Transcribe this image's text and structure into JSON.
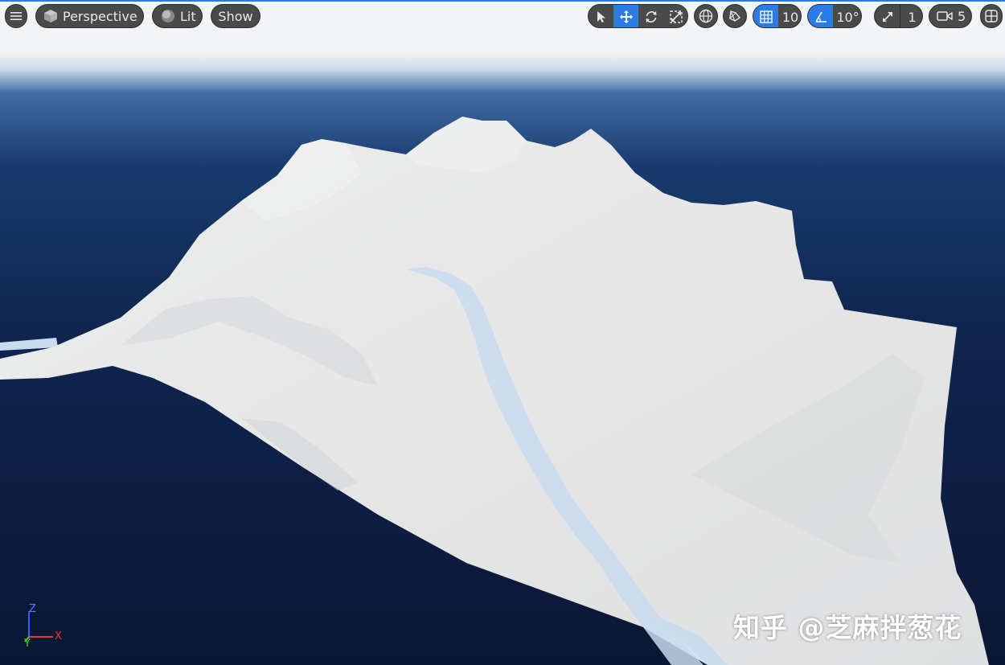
{
  "toolbar": {
    "view_mode_label": "Perspective",
    "lighting_label": "Lit",
    "show_label": "Show",
    "grid_snap_value": "10",
    "rotation_snap_value": "10°",
    "scale_snap_value": "1",
    "camera_speed_value": "5",
    "active_transform_tool": "translate",
    "icons": [
      "menu-icon",
      "perspective-cube-icon",
      "lit-sphere-icon",
      "select-arrow-icon",
      "translate-icon",
      "rotate-icon",
      "scale-icon",
      "world-local-icon",
      "surface-snap-icon",
      "grid-snap-icon",
      "rotation-snap-icon",
      "scale-snap-icon",
      "camera-speed-icon",
      "layout-icon"
    ]
  },
  "axis_gizmo": {
    "x": "X",
    "y": "Y",
    "z": "Z"
  },
  "watermark": "知乎 @芝麻拌葱花",
  "colors": {
    "accent": "#2d7be6",
    "toolbar_button": "#4a4a4a",
    "sky_top": "#f2f4f6",
    "ocean": "#0c1c3a",
    "terrain": "#e4e5e5",
    "river": "#c7dbef"
  }
}
